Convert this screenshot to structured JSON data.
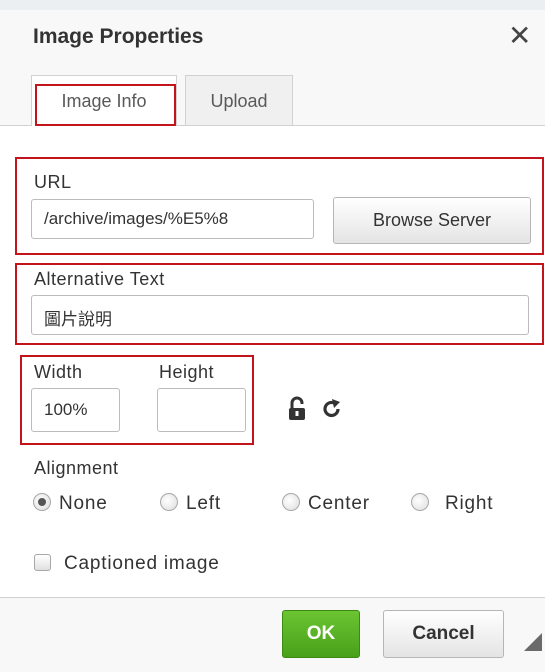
{
  "dialog": {
    "title": "Image Properties",
    "close_symbol": "✕"
  },
  "tabs": [
    {
      "label": "Image Info",
      "active": true
    },
    {
      "label": "Upload",
      "active": false
    }
  ],
  "url": {
    "label": "URL",
    "value": "/archive/images/%E5%8",
    "browse_label": "Browse Server"
  },
  "alt_text": {
    "label": "Alternative Text",
    "value": "圖片說明"
  },
  "size": {
    "width_label": "Width",
    "width_value": "100%",
    "height_label": "Height",
    "height_value": "",
    "lock_icon": "lock-open-icon",
    "reset_icon": "reset-size-icon"
  },
  "alignment": {
    "label": "Alignment",
    "options": [
      "None",
      "Left",
      "Center",
      "Right"
    ],
    "selected": "None"
  },
  "caption": {
    "label": "Captioned image",
    "checked": false
  },
  "footer": {
    "ok_label": "OK",
    "cancel_label": "Cancel"
  },
  "colors": {
    "highlight_border": "#c4141b",
    "ok_button": "#5cb521"
  }
}
